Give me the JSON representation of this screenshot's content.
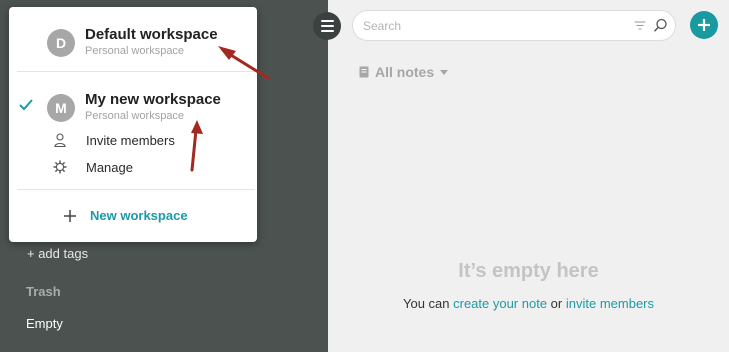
{
  "sidebar": {
    "add_tags": "+ add tags",
    "trash_section": "Trash",
    "trash_item": "Empty"
  },
  "search": {
    "placeholder": "Search"
  },
  "notes": {
    "header": "All notes"
  },
  "empty_state": {
    "title": "It’s empty here",
    "prefix": "You can ",
    "create_link": "create your note",
    "middle": " or ",
    "invite_link": "invite members"
  },
  "workspace_menu": {
    "workspaces": [
      {
        "initial": "D",
        "name": "Default workspace",
        "subtitle": "Personal workspace",
        "selected": false
      },
      {
        "initial": "M",
        "name": "My new workspace",
        "subtitle": "Personal workspace",
        "selected": true
      }
    ],
    "items": [
      {
        "label": "Invite members",
        "icon": "person-icon"
      },
      {
        "label": "Manage",
        "icon": "gear-icon"
      }
    ],
    "new_workspace": "New workspace"
  },
  "colors": {
    "accent": "#1a9aa0",
    "sidebar_bg": "#4b5250",
    "annotation_arrow": "#a3281f"
  }
}
